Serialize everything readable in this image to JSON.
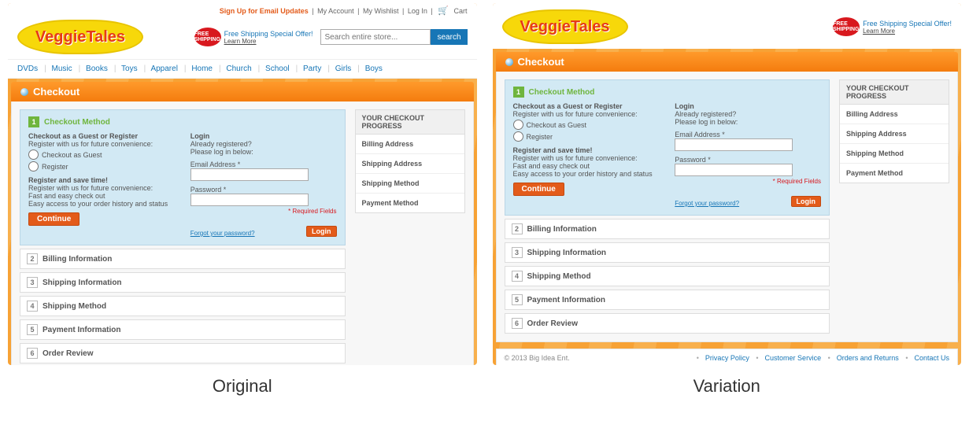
{
  "captions": {
    "left": "Original",
    "right": "Variation"
  },
  "toplinks": {
    "signup": "Sign Up for Email Updates",
    "account": "My Account",
    "wishlist": "My Wishlist",
    "login": "Log In",
    "cart": "Cart"
  },
  "logo_text": "VeggieTales",
  "freeship": {
    "badge": "FREE SHIPPING",
    "line": "Free Shipping Special Offer!",
    "learn": "Learn More"
  },
  "search": {
    "placeholder": "Search entire store...",
    "button": "search"
  },
  "nav": [
    "DVDs",
    "Music",
    "Books",
    "Toys",
    "Apparel",
    "Home",
    "Church",
    "School",
    "Party",
    "Girls",
    "Boys"
  ],
  "titlebar": "Checkout",
  "step1": {
    "num": "1",
    "title": "Checkout Method",
    "guest_hd": "Checkout as a Guest or Register",
    "guest_sub": "Register with us for future convenience:",
    "opt_guest": "Checkout as Guest",
    "opt_register": "Register",
    "save_hd": "Register and save time!",
    "save_sub": "Register with us for future convenience:",
    "save_b1": "Fast and easy check out",
    "save_b2": "Easy access to your order history and status",
    "continue": "Continue",
    "login_hd": "Login",
    "login_sub": "Already registered?",
    "login_sub2": "Please log in below:",
    "email_lbl": "Email Address *",
    "pwd_lbl": "Password *",
    "required": "* Required Fields",
    "forgot": "Forgot your password?",
    "login_btn": "Login"
  },
  "steps_closed": [
    {
      "num": "2",
      "label": "Billing Information"
    },
    {
      "num": "3",
      "label": "Shipping Information"
    },
    {
      "num": "4",
      "label": "Shipping Method"
    },
    {
      "num": "5",
      "label": "Payment Information"
    },
    {
      "num": "6",
      "label": "Order Review"
    }
  ],
  "progress": {
    "header": "YOUR CHECKOUT PROGRESS",
    "items": [
      "Billing Address",
      "Shipping Address",
      "Shipping Method",
      "Payment Method"
    ]
  },
  "footer": {
    "copyright": "© 2013 Big Idea Ent.",
    "links": [
      "Privacy Policy",
      "Customer Service",
      "Orders and Returns",
      "Contact Us"
    ]
  }
}
